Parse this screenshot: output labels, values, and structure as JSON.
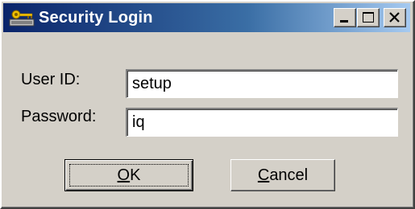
{
  "window": {
    "title": "Security Login",
    "colors": {
      "titlebar_start": "#0a246a",
      "titlebar_end": "#a6caf0",
      "face": "#d4d0c8"
    },
    "controls": {
      "minimize_icon": "minimize-icon",
      "maximize_icon": "maximize-icon",
      "close_icon": "close-icon"
    }
  },
  "form": {
    "user_id_label": "User ID:",
    "user_id_value": "setup",
    "password_label": "Password:",
    "password_value": "iq"
  },
  "buttons": {
    "ok": {
      "mnemonic": "O",
      "rest": "K"
    },
    "cancel": {
      "mnemonic": "C",
      "rest": "ancel"
    }
  }
}
